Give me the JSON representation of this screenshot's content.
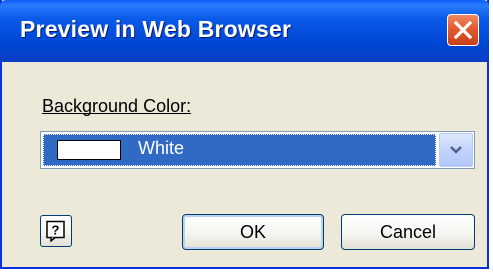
{
  "window": {
    "title": "Preview in Web Browser"
  },
  "icons": {
    "close": "close-icon",
    "dropdown": "chevron-down-icon",
    "help": "help-icon"
  },
  "form": {
    "background_color_label": "Background Color:",
    "background_color_value": "White",
    "swatch_color": "#ffffff"
  },
  "buttons": {
    "ok_label": "OK",
    "cancel_label": "Cancel"
  },
  "colors": {
    "titlebar": "#0054e3",
    "selection": "#316ac5",
    "dialog_face": "#ece9d8",
    "close_button": "#e25a2d"
  }
}
